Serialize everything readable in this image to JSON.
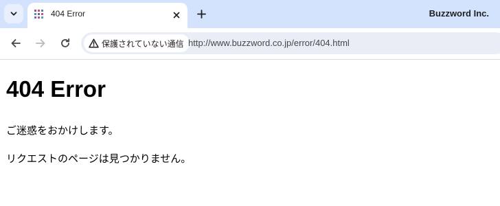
{
  "tab": {
    "title": "404 Error",
    "favicon_icon": "page-grid-icon",
    "close_icon": "close-icon"
  },
  "tabstrip": {
    "tab_search_icon": "chevron-down-icon",
    "new_tab_icon": "plus-icon",
    "profile_label": "Buzzword Inc."
  },
  "toolbar": {
    "back_icon": "arrow-left-icon",
    "forward_icon": "arrow-right-icon",
    "reload_icon": "reload-icon",
    "security_icon": "warning-icon",
    "security_text": "保護されていない通信",
    "url": "http://www.buzzword.co.jp/error/404.html"
  },
  "page": {
    "heading": "404 Error",
    "paragraphs": [
      "ご迷惑をおかけします。",
      "リクエストのページは見つかりません。"
    ]
  },
  "colors": {
    "tabstrip_bg": "#d3e3fd",
    "omnibox_bg": "#e9eef6",
    "icon": "#444746"
  }
}
